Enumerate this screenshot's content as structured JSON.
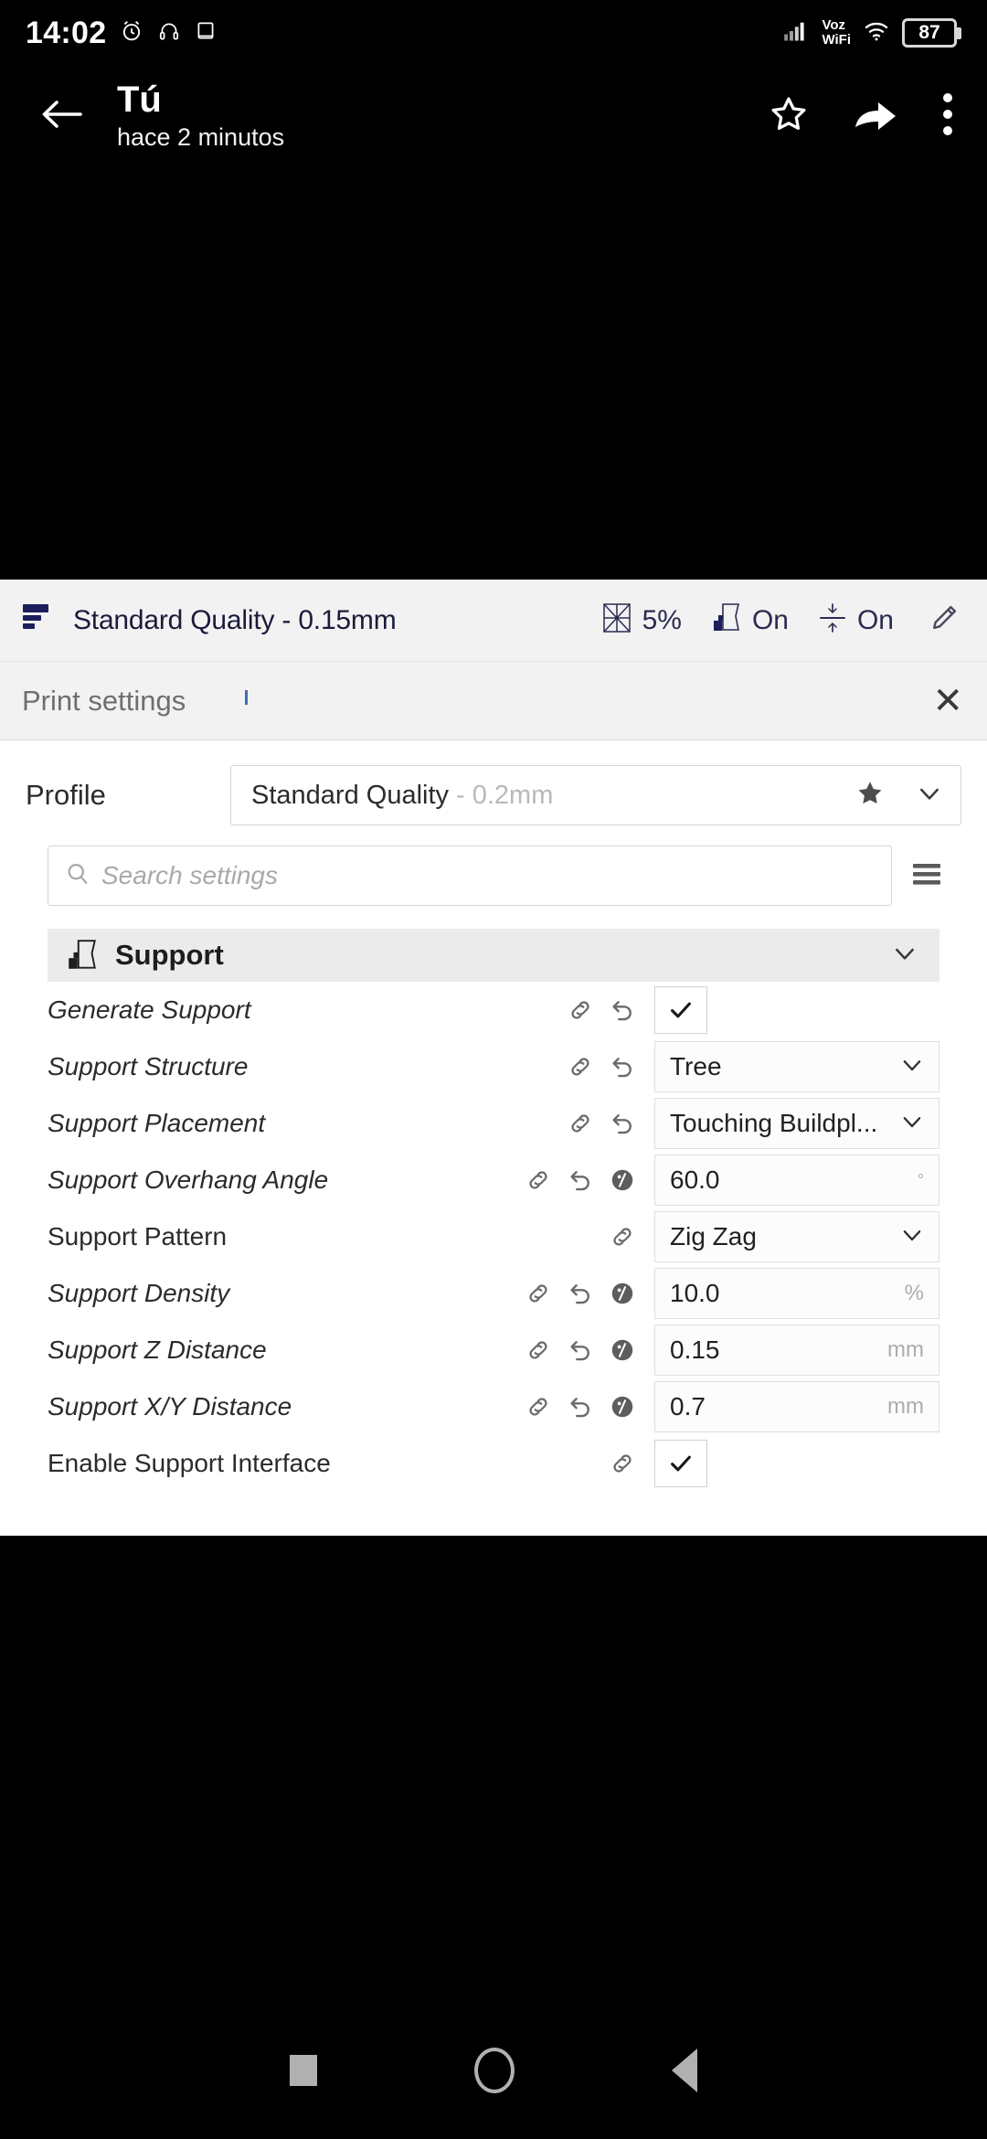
{
  "status_bar": {
    "time": "14:02",
    "icons_left": [
      "alarm-icon",
      "headphones-icon",
      "tablet-icon"
    ],
    "network_label_line1": "Voz",
    "network_label_line2": "WiFi",
    "icons_right": [
      "signal-bars-icon",
      "wifi-icon"
    ],
    "battery_level": "87"
  },
  "app_bar": {
    "back_icon": "arrow-left-icon",
    "title": "Tú",
    "subtitle": "hace 2 minutos",
    "actions": [
      "star-outline-icon",
      "share-icon",
      "overflow-menu-icon"
    ]
  },
  "cura": {
    "toolbar": {
      "layers_icon": "layers-icon",
      "quality_text": "Standard Quality - 0.15mm",
      "infill_icon": "infill-icon",
      "infill_value": "5%",
      "support_icon": "support-icon",
      "support_value": "On",
      "adhesion_icon": "adhesion-icon",
      "adhesion_value": "On",
      "edit_icon": "pencil-icon"
    },
    "panel": {
      "title": "Print settings",
      "close_label": "✕",
      "profile": {
        "label": "Profile",
        "value": "Standard Quality",
        "value_suffix": " - 0.2mm",
        "star_icon": "star-filled-icon",
        "chevron_icon": "chevron-down-icon"
      },
      "search": {
        "icon": "search-icon",
        "placeholder": "Search settings",
        "menu_icon": "hamburger-menu-icon"
      },
      "section": {
        "icon": "support-icon",
        "title": "Support",
        "collapse_icon": "chevron-down-icon"
      },
      "settings": [
        {
          "label": "Generate Support",
          "italic": true,
          "icons": [
            "link-icon",
            "revert-icon"
          ],
          "control": "checkbox",
          "checked": true,
          "value": "",
          "unit": ""
        },
        {
          "label": "Support Structure",
          "italic": true,
          "icons": [
            "link-icon",
            "revert-icon"
          ],
          "control": "select",
          "value": "Tree",
          "unit": ""
        },
        {
          "label": "Support Placement",
          "italic": true,
          "icons": [
            "link-icon",
            "revert-icon"
          ],
          "control": "select",
          "value": "Touching Buildpl...",
          "unit": ""
        },
        {
          "label": "Support Overhang Angle",
          "italic": true,
          "icons": [
            "link-icon",
            "revert-icon",
            "formula-icon"
          ],
          "control": "input",
          "value": "60.0",
          "unit": "°"
        },
        {
          "label": "Support Pattern",
          "italic": false,
          "icons": [
            "link-icon"
          ],
          "control": "select",
          "value": "Zig Zag",
          "unit": ""
        },
        {
          "label": "Support Density",
          "italic": true,
          "icons": [
            "link-icon",
            "revert-icon",
            "formula-icon"
          ],
          "control": "input",
          "value": "10.0",
          "unit": "%"
        },
        {
          "label": "Support Z Distance",
          "italic": true,
          "icons": [
            "link-icon",
            "revert-icon",
            "formula-icon"
          ],
          "control": "input",
          "value": "0.15",
          "unit": "mm"
        },
        {
          "label": "Support X/Y Distance",
          "italic": true,
          "icons": [
            "link-icon",
            "revert-icon",
            "formula-icon"
          ],
          "control": "input",
          "value": "0.7",
          "unit": "mm"
        },
        {
          "label": "Enable Support Interface",
          "italic": false,
          "icons": [
            "link-icon"
          ],
          "control": "checkbox",
          "checked": true,
          "value": "",
          "unit": ""
        }
      ]
    },
    "colors": {
      "accent_navy": "#1c1f5c",
      "panel_grey": "#f2f2f2",
      "section_grey": "#ebebeb",
      "tick_blue": "#3d6fb4"
    }
  },
  "nav_bar": {
    "recents_label": "recents-square-icon",
    "home_label": "home-circle-icon",
    "back_label": "back-triangle-icon"
  }
}
